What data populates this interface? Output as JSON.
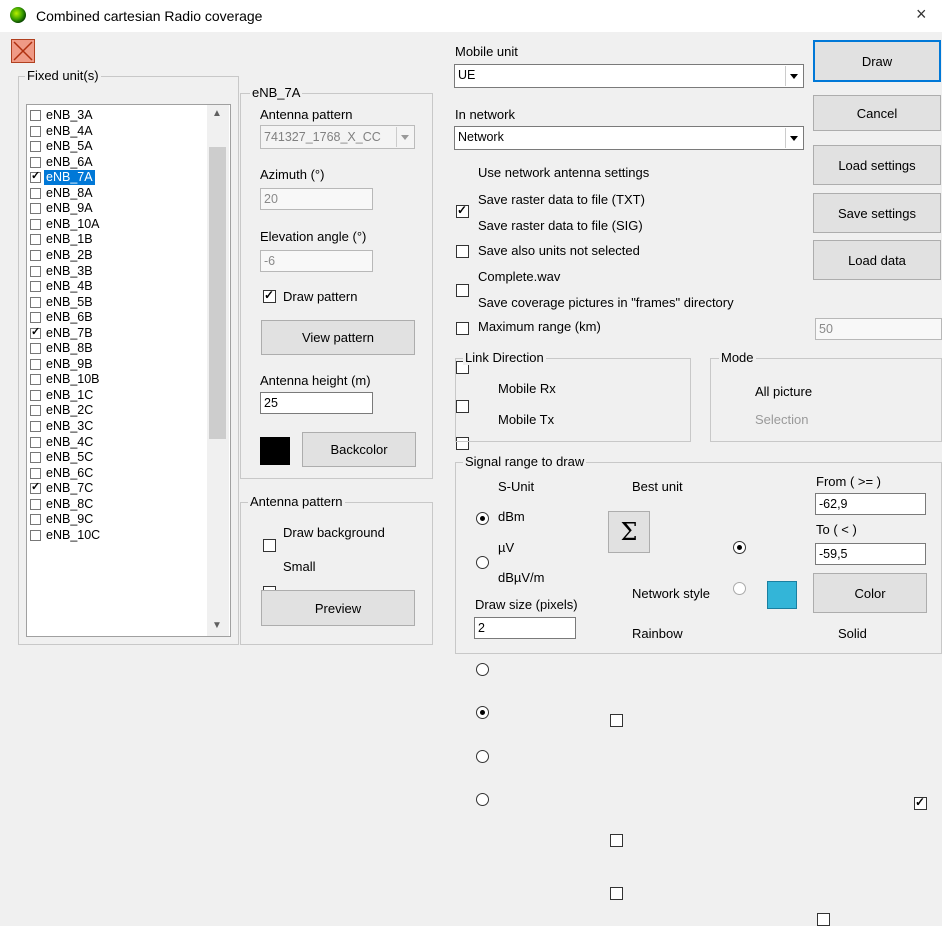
{
  "window": {
    "title": "Combined cartesian Radio coverage",
    "close_glyph": "×"
  },
  "fixed_units": {
    "label": "Fixed unit(s)",
    "items": [
      {
        "label": "eNB_3A",
        "checked": false,
        "selected": false
      },
      {
        "label": "eNB_4A",
        "checked": false,
        "selected": false
      },
      {
        "label": "eNB_5A",
        "checked": false,
        "selected": false
      },
      {
        "label": "eNB_6A",
        "checked": false,
        "selected": false
      },
      {
        "label": "eNB_7A",
        "checked": true,
        "selected": true
      },
      {
        "label": "eNB_8A",
        "checked": false,
        "selected": false
      },
      {
        "label": "eNB_9A",
        "checked": false,
        "selected": false
      },
      {
        "label": "eNB_10A",
        "checked": false,
        "selected": false
      },
      {
        "label": "eNB_1B",
        "checked": false,
        "selected": false
      },
      {
        "label": "eNB_2B",
        "checked": false,
        "selected": false
      },
      {
        "label": "eNB_3B",
        "checked": false,
        "selected": false
      },
      {
        "label": "eNB_4B",
        "checked": false,
        "selected": false
      },
      {
        "label": "eNB_5B",
        "checked": false,
        "selected": false
      },
      {
        "label": "eNB_6B",
        "checked": false,
        "selected": false
      },
      {
        "label": "eNB_7B",
        "checked": true,
        "selected": false
      },
      {
        "label": "eNB_8B",
        "checked": false,
        "selected": false
      },
      {
        "label": "eNB_9B",
        "checked": false,
        "selected": false
      },
      {
        "label": "eNB_10B",
        "checked": false,
        "selected": false
      },
      {
        "label": "eNB_1C",
        "checked": false,
        "selected": false
      },
      {
        "label": "eNB_2C",
        "checked": false,
        "selected": false
      },
      {
        "label": "eNB_3C",
        "checked": false,
        "selected": false
      },
      {
        "label": "eNB_4C",
        "checked": false,
        "selected": false
      },
      {
        "label": "eNB_5C",
        "checked": false,
        "selected": false
      },
      {
        "label": "eNB_6C",
        "checked": false,
        "selected": false
      },
      {
        "label": "eNB_7C",
        "checked": true,
        "selected": false
      },
      {
        "label": "eNB_8C",
        "checked": false,
        "selected": false
      },
      {
        "label": "eNB_9C",
        "checked": false,
        "selected": false
      },
      {
        "label": "eNB_10C",
        "checked": false,
        "selected": false
      }
    ]
  },
  "unit_panel": {
    "title": "eNB_7A",
    "antenna_pattern_label": "Antenna pattern",
    "antenna_pattern_value": "741327_1768_X_CC",
    "azimuth_label": "Azimuth (°)",
    "azimuth_value": "20",
    "elevation_label": "Elevation angle (°)",
    "elevation_value": "-6",
    "draw_pattern_label": "Draw pattern",
    "draw_pattern_checked": true,
    "view_pattern_label": "View pattern",
    "antenna_height_label": "Antenna height (m)",
    "antenna_height_value": "25",
    "backcolor_label": "Backcolor",
    "backcolor": "#000000"
  },
  "antenna_pattern_group": {
    "title": "Antenna pattern",
    "draw_background_label": "Draw background",
    "small_label": "Small",
    "preview_label": "Preview"
  },
  "mobile": {
    "mobile_unit_label": "Mobile unit",
    "mobile_unit_value": "UE",
    "network_label": "In network",
    "network_value": "Network"
  },
  "options": [
    {
      "label": "Use network antenna settings",
      "checked": true
    },
    {
      "label": "Save raster data to file (TXT)",
      "checked": false
    },
    {
      "label": "Save raster data to file (SIG)",
      "checked": false
    },
    {
      "label": "Save also units not selected",
      "checked": false
    },
    {
      "label": "Complete.wav",
      "checked": false
    },
    {
      "label": "Save coverage pictures in \"frames\" directory",
      "checked": false
    },
    {
      "label": "Maximum range (km)",
      "checked": false
    }
  ],
  "max_range_value": "50",
  "actions": {
    "draw": "Draw",
    "cancel": "Cancel",
    "load_settings": "Load settings",
    "save_settings": "Save settings",
    "load_data": "Load data"
  },
  "link_direction": {
    "title": "Link Direction",
    "mobile_rx": "Mobile Rx",
    "mobile_tx": "Mobile Tx",
    "selected": "Mobile Rx"
  },
  "mode": {
    "title": "Mode",
    "all_picture": "All picture",
    "selection": "Selection",
    "selected": "All picture"
  },
  "signal_range": {
    "title": "Signal range to draw",
    "units": [
      "S-Unit",
      "dBm",
      "µV",
      "dBµV/m"
    ],
    "selected_unit": "dBm",
    "best_unit_label": "Best unit",
    "sigma": "Σ",
    "network_style_label": "Network style",
    "rainbow_label": "Rainbow",
    "draw_size_label": "Draw size (pixels)",
    "draw_size_value": "2",
    "from_label": "From ( >= )",
    "from_value": "-62,9",
    "to_label": "To ( < )",
    "to_checked": true,
    "to_value": "-59,5",
    "color_label": "Color",
    "color_swatch": "#33b5d8",
    "solid_label": "Solid"
  }
}
